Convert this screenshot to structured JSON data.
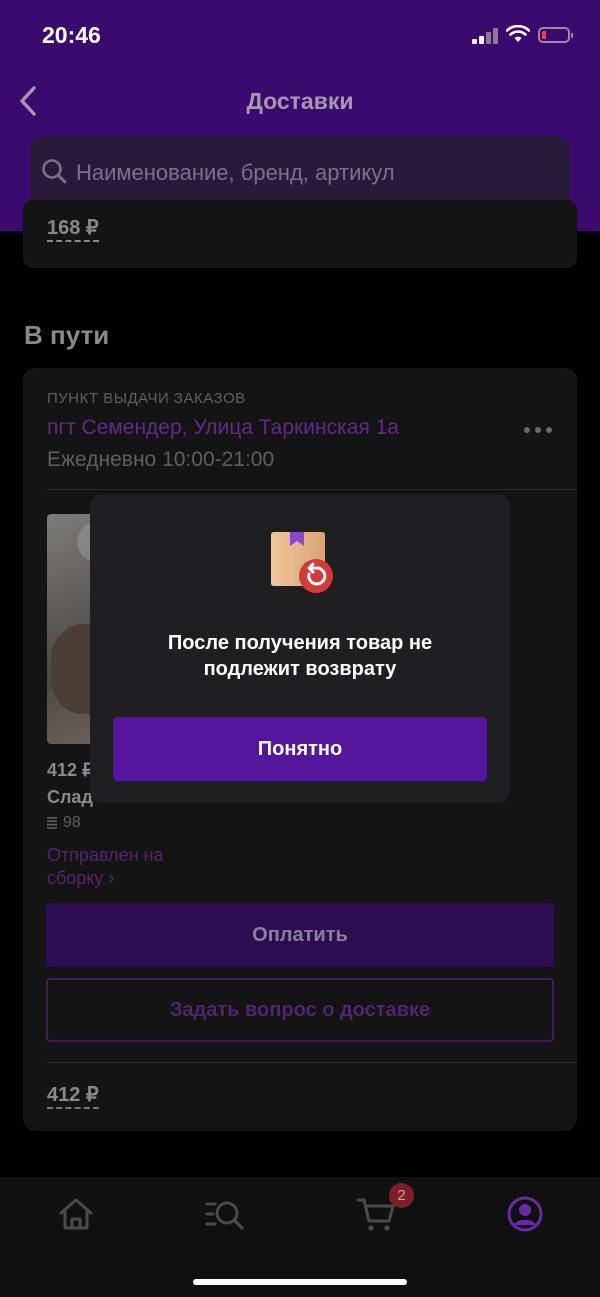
{
  "status_bar": {
    "time": "20:46"
  },
  "header": {
    "title": "Доставки"
  },
  "search": {
    "placeholder": "Наименование, бренд, артикул"
  },
  "previous_card": {
    "price": "168 ₽"
  },
  "section": {
    "title": "В пути"
  },
  "delivery_card": {
    "pickup_label": "ПУНКТ ВЫДАЧИ ЗАКАЗОВ",
    "address": "пгт Семендер, Улица Таркинская 1а",
    "hours": "Ежедневно 10:00-21:00",
    "item": {
      "price": "412 ₽",
      "name": "Слад",
      "article": "98",
      "status": "Отправлен на сборку ›"
    },
    "pay_button": "Оплатить",
    "ask_button": "Задать вопрос о доставке",
    "total": "412 ₽"
  },
  "modal": {
    "text": "После получения товар не подлежит возврату",
    "button": "Понятно"
  },
  "tabbar": {
    "cart_badge": "2",
    "icons": [
      "home-icon",
      "catalog-search-icon",
      "cart-icon",
      "profile-icon"
    ],
    "active_color": "#6a2aa8"
  }
}
